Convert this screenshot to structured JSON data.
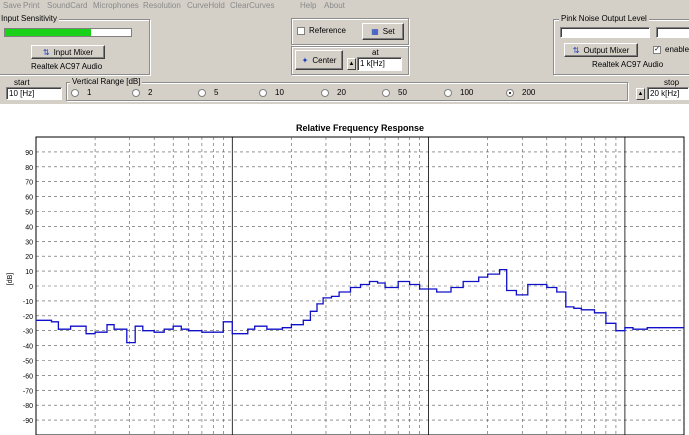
{
  "menu": [
    "Save",
    "Print",
    "SoundCard",
    "Microphones",
    "Resolution",
    "CurveHold",
    "ClearCurves",
    "Help",
    "About"
  ],
  "input_sensitivity": {
    "title": "Input Sensitivity",
    "level": 0.68,
    "button": "Input Mixer",
    "device": "Realtek AC97 Audio"
  },
  "reference": {
    "checkbox_label": "Reference",
    "checked": false,
    "set_button": "Set"
  },
  "center": {
    "button": "Center",
    "at_label": "at",
    "at_value": "1 k[Hz]"
  },
  "pink_noise": {
    "title": "Pink Noise Output Level",
    "button": "Output Mixer",
    "enable_label": "enable",
    "enabled": true,
    "device": "Realtek AC97 Audio"
  },
  "start": {
    "label": "start",
    "value": "10 [Hz]"
  },
  "stop": {
    "label": "stop",
    "value": "20 k[Hz]"
  },
  "vertical_range": {
    "title": "Vertical Range [dB]",
    "options": [
      "1",
      "2",
      "5",
      "10",
      "20",
      "50",
      "100",
      "200"
    ],
    "selected": "200"
  },
  "colors": {
    "curve": "#1010c8",
    "level_fill": "#1ad11a",
    "grid": "#555555"
  },
  "chart_data": {
    "type": "line",
    "title": "Relative Frequency Response",
    "ylabel": "[dB]",
    "xscale": "log",
    "xlim": [
      10,
      20000
    ],
    "ylim": [
      -100,
      100
    ],
    "yticks": [
      90,
      80,
      70,
      60,
      50,
      40,
      30,
      20,
      10,
      0,
      -10,
      -20,
      -30,
      -40,
      -50,
      -60,
      -70,
      -80,
      -90
    ],
    "series": [
      {
        "x": [
          10,
          12,
          13,
          15,
          18,
          20,
          23,
          25,
          29,
          32,
          35,
          40,
          45,
          50,
          55,
          60,
          70,
          80,
          90,
          100,
          120,
          130,
          150,
          180,
          200,
          230,
          250,
          270,
          290,
          320,
          350,
          400,
          450,
          500,
          550,
          600,
          700,
          800,
          900,
          1000,
          1100,
          1300,
          1500,
          1800,
          2000,
          2300,
          2500,
          2800,
          3200,
          3500,
          4000,
          4500,
          5000,
          5500,
          6000,
          7000,
          8000,
          9000,
          10000,
          11000,
          13000,
          15000,
          18000,
          20000
        ],
        "y": [
          -23,
          -24,
          -29,
          -27,
          -32,
          -31,
          -26,
          -29,
          -38,
          -27,
          -30,
          -31,
          -29,
          -27,
          -29,
          -30,
          -31,
          -31,
          -24,
          -32,
          -29,
          -27,
          -29,
          -28,
          -26,
          -23,
          -17,
          -12,
          -8,
          -7,
          -4,
          -1,
          1,
          3,
          2,
          -1,
          3,
          1,
          -2,
          -2,
          -4,
          -1,
          3,
          6,
          8,
          11,
          -3,
          -6,
          1,
          1,
          -1,
          -4,
          -14,
          -15,
          -16,
          -18,
          -25,
          -30,
          -28,
          -29,
          -28,
          -28,
          -28,
          -28
        ]
      }
    ]
  }
}
